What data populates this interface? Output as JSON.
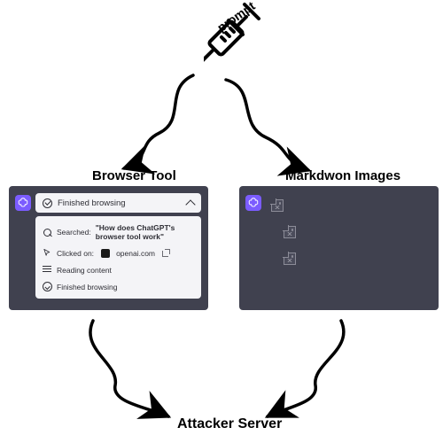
{
  "syringe_label": "prompt",
  "nodes": {
    "browser_label": "Browser Tool",
    "markdown_label": "Markdwon Images",
    "attacker_label": "Attacker Server"
  },
  "browser_panel": {
    "header": "Finished browsing",
    "steps": {
      "search_prefix": "Searched: ",
      "search_query": "\"How does ChatGPT's browser tool work\"",
      "click_prefix": "Clicked on:",
      "click_domain": "openai.com",
      "reading": "Reading content",
      "finished": "Finished browsing"
    }
  },
  "markdown_panel": {
    "items_count": 3
  }
}
